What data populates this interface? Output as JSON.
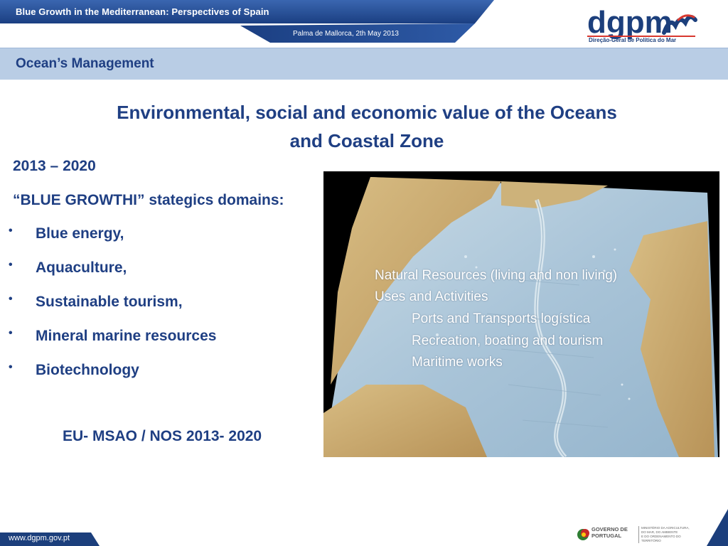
{
  "header": {
    "title": "Blue Growth in the Mediterranean: Perspectives of Spain",
    "subtitle": "Palma de Mallorca, 2th May 2013",
    "logo": {
      "wordmark": "dgpm",
      "caption": "Direção-Geral de Política do Mar"
    }
  },
  "section": {
    "title": "Ocean’s Management"
  },
  "main": {
    "title_line1": "Environmental, social and economic value of the Oceans",
    "title_line2": "and Coastal Zone",
    "period": "2013 – 2020",
    "domains_heading": "“BLUE GROWTHI” stategics domains:",
    "domains": [
      "Blue energy,",
      "Aquaculture,",
      "Sustainable tourism,",
      "Mineral marine resources",
      "Biotechnology"
    ],
    "eu_label": "EU- MSAO / NOS 2013- 2020"
  },
  "map_overlay": {
    "line1": "Natural Resources (living and non living)",
    "line2": "Uses and Activities",
    "line3": "Ports and Transports logística",
    "line4": "Recreation, boating and tourism",
    "line5": "Maritime works"
  },
  "footer": {
    "url": "www.dgpm.gov.pt",
    "gov_name_line1": "GOVERNO DE",
    "gov_name_line2": "PORTUGAL",
    "ministry_line1": "MINISTÉRIO DA AGRICULTURA,",
    "ministry_line2": "DO MAR, DO AMBIENTE",
    "ministry_line3": "E DO ORDENAMENTO DO TERRITÓRIO"
  },
  "colors": {
    "navy": "#1f3f83",
    "header_blue": "#1c3f7c",
    "section_bar": "#b9cde5",
    "ocean": "#a9c4d8",
    "land": "#c9a86a"
  }
}
